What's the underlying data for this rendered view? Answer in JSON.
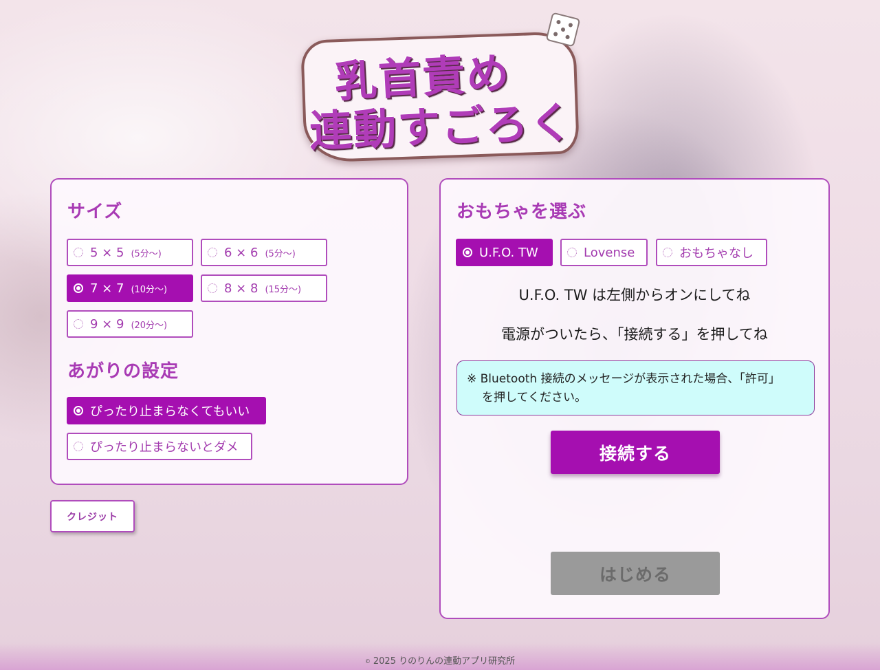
{
  "logo": {
    "line1": "乳首責め",
    "line2": "連動すごろく",
    "icon": "dice-icon"
  },
  "size_section": {
    "title": "サイズ",
    "options": [
      {
        "label": "5 × 5",
        "sub": "(5分〜)",
        "selected": false
      },
      {
        "label": "6 × 6",
        "sub": "(5分〜)",
        "selected": false
      },
      {
        "label": "7 × 7",
        "sub": "(10分〜)",
        "selected": true
      },
      {
        "label": "8 × 8",
        "sub": "(15分〜)",
        "selected": false
      },
      {
        "label": "9 × 9",
        "sub": "(20分〜)",
        "selected": false
      }
    ]
  },
  "finish_section": {
    "title": "あがりの設定",
    "options": [
      {
        "label": "ぴったり止まらなくてもいい",
        "selected": true
      },
      {
        "label": "ぴったり止まらないとダメ",
        "selected": false
      }
    ]
  },
  "credit": {
    "label": "クレジット"
  },
  "toy_section": {
    "title": "おもちゃを選ぶ",
    "options": [
      {
        "label": "U.F.O. TW",
        "selected": true
      },
      {
        "label": "Lovense",
        "selected": false
      },
      {
        "label": "おもちゃなし",
        "selected": false
      }
    ],
    "message1": "U.F.O. TW は左側からオンにしてね",
    "message2": "電源がついたら、「接続する」を押してね",
    "notice_line1": "※ Bluetooth 接続のメッセージが表示された場合、「許可」",
    "notice_line2": "を押してください。",
    "connect_label": "接続する",
    "start_label": "はじめる"
  },
  "footer": {
    "copyright_symbol": "©",
    "text": "2025 りのりんの連動アプリ研究所"
  },
  "colors": {
    "accent": "#a50fb0",
    "title": "#a83ab4",
    "notice_bg": "#cffcfb",
    "disabled": "#9a9a9a"
  }
}
